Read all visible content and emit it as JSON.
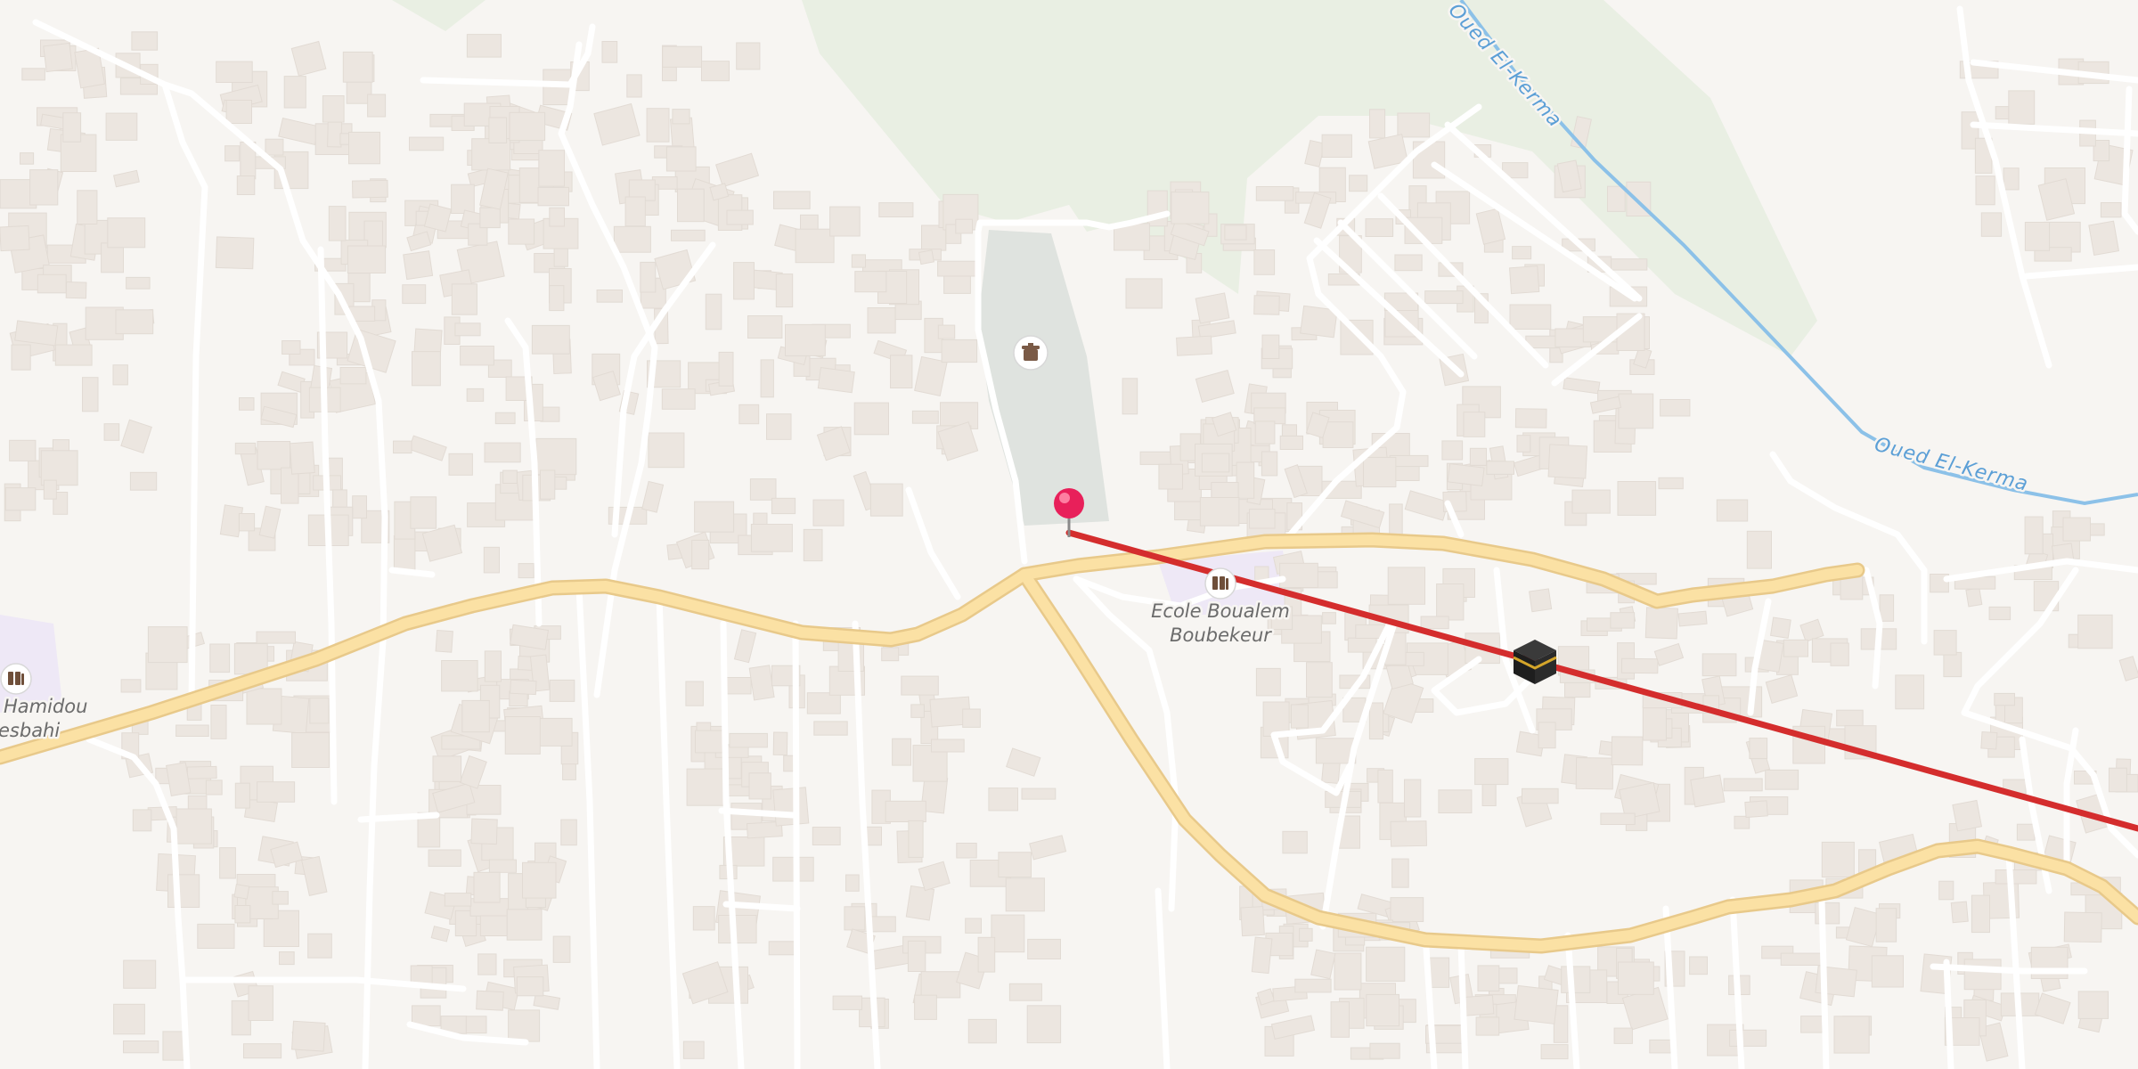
{
  "map": {
    "colors": {
      "background": "#f7f5f2",
      "green_area": "#e9efe3",
      "cemetery": "#dfe3df",
      "school_area": "#eee8f6",
      "water": "#8cc1e8",
      "main_road_fill": "#fbe1a4",
      "main_road_casing": "#e8c98a",
      "minor_road": "#ffffff",
      "building": "#ece6e0",
      "route_line": "#d42d2d",
      "pin": "#e8205a"
    },
    "labels": {
      "school_main": [
        "Ecole Boualem",
        "Boubekeur"
      ],
      "school_left": [
        "Hamidou",
        "esbahi"
      ],
      "river_upper": "Oued El-Kerma",
      "river_lower": "Oued El-Kerma"
    },
    "icons": {
      "school_main": "school-icon",
      "school_left": "school-icon",
      "cemetery": "cemetery-icon",
      "mosque": "kaaba-icon",
      "pin": "location-pin-icon"
    }
  }
}
